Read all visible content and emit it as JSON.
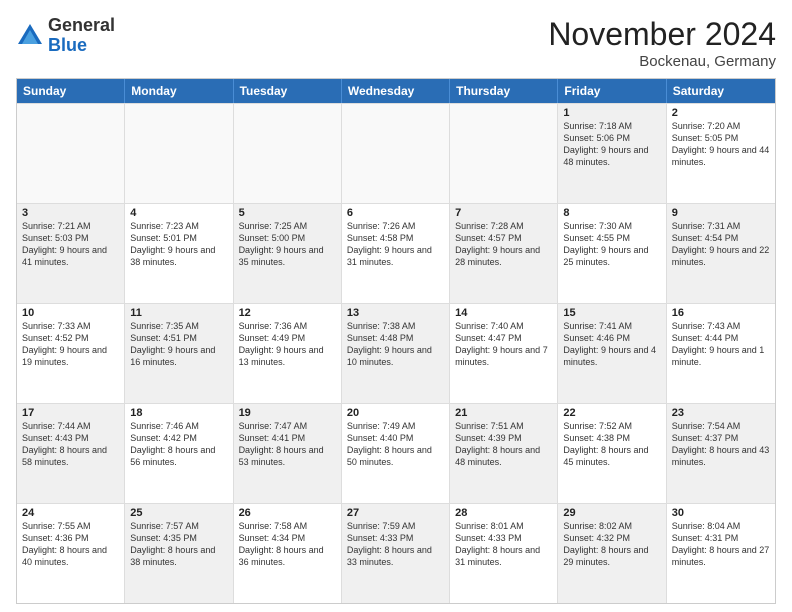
{
  "header": {
    "logo_general": "General",
    "logo_blue": "Blue",
    "month_title": "November 2024",
    "location": "Bockenau, Germany"
  },
  "calendar": {
    "days_of_week": [
      "Sunday",
      "Monday",
      "Tuesday",
      "Wednesday",
      "Thursday",
      "Friday",
      "Saturday"
    ],
    "rows": [
      [
        {
          "day": "",
          "info": "",
          "shaded": false,
          "empty": true
        },
        {
          "day": "",
          "info": "",
          "shaded": false,
          "empty": true
        },
        {
          "day": "",
          "info": "",
          "shaded": false,
          "empty": true
        },
        {
          "day": "",
          "info": "",
          "shaded": false,
          "empty": true
        },
        {
          "day": "",
          "info": "",
          "shaded": false,
          "empty": true
        },
        {
          "day": "1",
          "info": "Sunrise: 7:18 AM\nSunset: 5:06 PM\nDaylight: 9 hours and 48 minutes.",
          "shaded": true
        },
        {
          "day": "2",
          "info": "Sunrise: 7:20 AM\nSunset: 5:05 PM\nDaylight: 9 hours and 44 minutes.",
          "shaded": false
        }
      ],
      [
        {
          "day": "3",
          "info": "Sunrise: 7:21 AM\nSunset: 5:03 PM\nDaylight: 9 hours and 41 minutes.",
          "shaded": true
        },
        {
          "day": "4",
          "info": "Sunrise: 7:23 AM\nSunset: 5:01 PM\nDaylight: 9 hours and 38 minutes.",
          "shaded": false
        },
        {
          "day": "5",
          "info": "Sunrise: 7:25 AM\nSunset: 5:00 PM\nDaylight: 9 hours and 35 minutes.",
          "shaded": true
        },
        {
          "day": "6",
          "info": "Sunrise: 7:26 AM\nSunset: 4:58 PM\nDaylight: 9 hours and 31 minutes.",
          "shaded": false
        },
        {
          "day": "7",
          "info": "Sunrise: 7:28 AM\nSunset: 4:57 PM\nDaylight: 9 hours and 28 minutes.",
          "shaded": true
        },
        {
          "day": "8",
          "info": "Sunrise: 7:30 AM\nSunset: 4:55 PM\nDaylight: 9 hours and 25 minutes.",
          "shaded": false
        },
        {
          "day": "9",
          "info": "Sunrise: 7:31 AM\nSunset: 4:54 PM\nDaylight: 9 hours and 22 minutes.",
          "shaded": true
        }
      ],
      [
        {
          "day": "10",
          "info": "Sunrise: 7:33 AM\nSunset: 4:52 PM\nDaylight: 9 hours and 19 minutes.",
          "shaded": false
        },
        {
          "day": "11",
          "info": "Sunrise: 7:35 AM\nSunset: 4:51 PM\nDaylight: 9 hours and 16 minutes.",
          "shaded": true
        },
        {
          "day": "12",
          "info": "Sunrise: 7:36 AM\nSunset: 4:49 PM\nDaylight: 9 hours and 13 minutes.",
          "shaded": false
        },
        {
          "day": "13",
          "info": "Sunrise: 7:38 AM\nSunset: 4:48 PM\nDaylight: 9 hours and 10 minutes.",
          "shaded": true
        },
        {
          "day": "14",
          "info": "Sunrise: 7:40 AM\nSunset: 4:47 PM\nDaylight: 9 hours and 7 minutes.",
          "shaded": false
        },
        {
          "day": "15",
          "info": "Sunrise: 7:41 AM\nSunset: 4:46 PM\nDaylight: 9 hours and 4 minutes.",
          "shaded": true
        },
        {
          "day": "16",
          "info": "Sunrise: 7:43 AM\nSunset: 4:44 PM\nDaylight: 9 hours and 1 minute.",
          "shaded": false
        }
      ],
      [
        {
          "day": "17",
          "info": "Sunrise: 7:44 AM\nSunset: 4:43 PM\nDaylight: 8 hours and 58 minutes.",
          "shaded": true
        },
        {
          "day": "18",
          "info": "Sunrise: 7:46 AM\nSunset: 4:42 PM\nDaylight: 8 hours and 56 minutes.",
          "shaded": false
        },
        {
          "day": "19",
          "info": "Sunrise: 7:47 AM\nSunset: 4:41 PM\nDaylight: 8 hours and 53 minutes.",
          "shaded": true
        },
        {
          "day": "20",
          "info": "Sunrise: 7:49 AM\nSunset: 4:40 PM\nDaylight: 8 hours and 50 minutes.",
          "shaded": false
        },
        {
          "day": "21",
          "info": "Sunrise: 7:51 AM\nSunset: 4:39 PM\nDaylight: 8 hours and 48 minutes.",
          "shaded": true
        },
        {
          "day": "22",
          "info": "Sunrise: 7:52 AM\nSunset: 4:38 PM\nDaylight: 8 hours and 45 minutes.",
          "shaded": false
        },
        {
          "day": "23",
          "info": "Sunrise: 7:54 AM\nSunset: 4:37 PM\nDaylight: 8 hours and 43 minutes.",
          "shaded": true
        }
      ],
      [
        {
          "day": "24",
          "info": "Sunrise: 7:55 AM\nSunset: 4:36 PM\nDaylight: 8 hours and 40 minutes.",
          "shaded": false
        },
        {
          "day": "25",
          "info": "Sunrise: 7:57 AM\nSunset: 4:35 PM\nDaylight: 8 hours and 38 minutes.",
          "shaded": true
        },
        {
          "day": "26",
          "info": "Sunrise: 7:58 AM\nSunset: 4:34 PM\nDaylight: 8 hours and 36 minutes.",
          "shaded": false
        },
        {
          "day": "27",
          "info": "Sunrise: 7:59 AM\nSunset: 4:33 PM\nDaylight: 8 hours and 33 minutes.",
          "shaded": true
        },
        {
          "day": "28",
          "info": "Sunrise: 8:01 AM\nSunset: 4:33 PM\nDaylight: 8 hours and 31 minutes.",
          "shaded": false
        },
        {
          "day": "29",
          "info": "Sunrise: 8:02 AM\nSunset: 4:32 PM\nDaylight: 8 hours and 29 minutes.",
          "shaded": true
        },
        {
          "day": "30",
          "info": "Sunrise: 8:04 AM\nSunset: 4:31 PM\nDaylight: 8 hours and 27 minutes.",
          "shaded": false
        }
      ]
    ]
  }
}
